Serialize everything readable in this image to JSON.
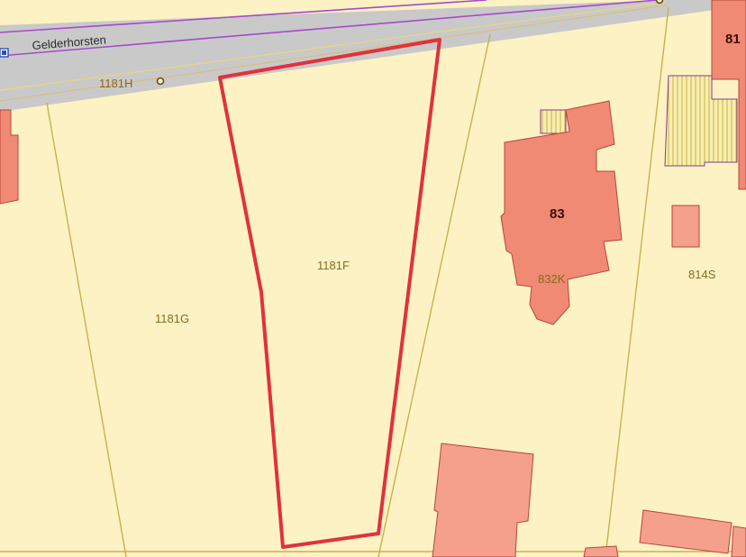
{
  "map": {
    "street_name": "Gelderhorsten",
    "parcels": {
      "road_parcel": "1181H",
      "selected": "1181F",
      "left": "1181G",
      "right_house": "832K",
      "far_right": "814S"
    },
    "house_numbers": {
      "main": "83",
      "top_right": "81"
    },
    "colors": {
      "parcel_fill": "#fdf2c4",
      "parcel_border": "#c9b24a",
      "road": "#c8c8c8",
      "road_line": "#a64ac9",
      "building": "#f08a74",
      "building_border": "#b5453a",
      "selection": "#e0323c"
    },
    "icons": [
      "road-marker-icon",
      "parcel-point-icon"
    ]
  }
}
